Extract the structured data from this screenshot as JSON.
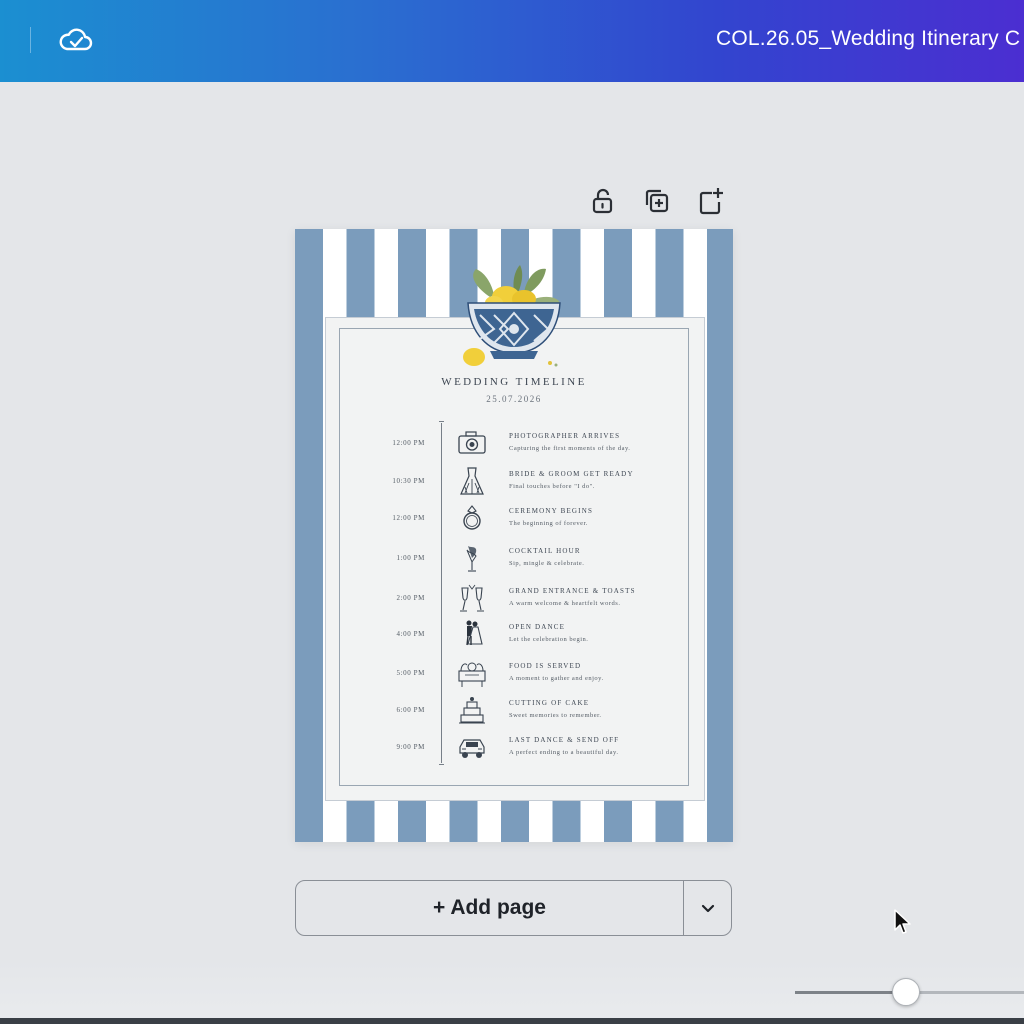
{
  "window": {
    "title": "COL.26.05_Wedding Itinerary C",
    "sync_icon": "cloud-check-icon"
  },
  "page_toolbar": {
    "lock_icon": "unlock-icon",
    "duplicate_icon": "duplicate-page-icon",
    "add_icon": "add-page-icon"
  },
  "document": {
    "title": "WEDDING TIMELINE",
    "date": "25.07.2026",
    "colors": {
      "stripe": "#7b9cbc",
      "card": "#f2f3f3",
      "text": "#3d4652"
    },
    "events": [
      {
        "time": "12:00 PM",
        "title": "PHOTOGRAPHER ARRIVES",
        "desc": "Capturing the first moments of the day.",
        "icon": "camera-icon"
      },
      {
        "time": "10:30 PM",
        "title": "BRIDE & GROOM GET READY",
        "desc": "Final touches before \"I do\".",
        "icon": "wedding-dress-icon"
      },
      {
        "time": "12:00 PM",
        "title": "CEREMONY BEGINS",
        "desc": "The beginning of forever.",
        "icon": "ring-icon"
      },
      {
        "time": "1:00 PM",
        "title": "COCKTAIL HOUR",
        "desc": "Sip, mingle & celebrate.",
        "icon": "cocktail-icon"
      },
      {
        "time": "2:00 PM",
        "title": "GRAND ENTRANCE & TOASTS",
        "desc": "A warm welcome & heartfelt words.",
        "icon": "champagne-glasses-icon"
      },
      {
        "time": "4:00 PM",
        "title": "OPEN DANCE",
        "desc": "Let the celebration begin.",
        "icon": "dancing-couple-icon"
      },
      {
        "time": "5:00 PM",
        "title": "FOOD IS SERVED",
        "desc": "A moment to gather and enjoy.",
        "icon": "dinner-table-icon"
      },
      {
        "time": "6:00 PM",
        "title": "CUTTING OF CAKE",
        "desc": "Sweet memories to remember.",
        "icon": "wedding-cake-icon"
      },
      {
        "time": "9:00 PM",
        "title": "LAST DANCE & SEND OFF",
        "desc": "A perfect ending to a beautiful day.",
        "icon": "getaway-car-icon"
      }
    ]
  },
  "add_page": {
    "label": "+ Add page",
    "dropdown_icon": "chevron-down-icon"
  },
  "zoom": {
    "level_fraction": 0.49
  }
}
